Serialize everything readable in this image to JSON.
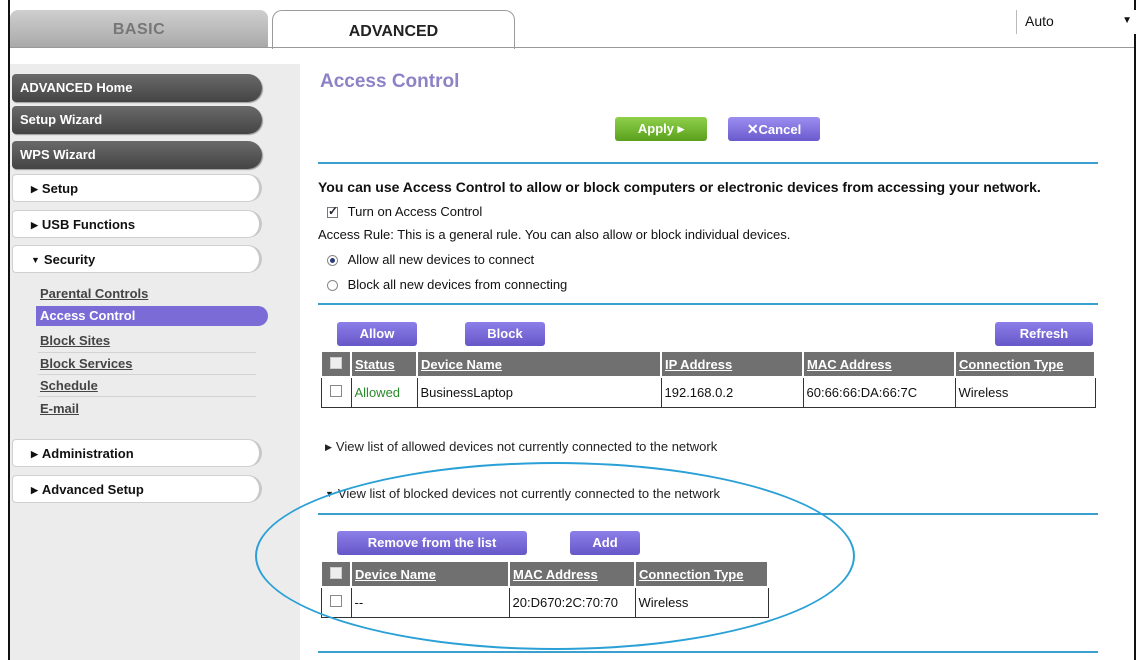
{
  "tabs": {
    "basic": "BASIC",
    "advanced": "ADVANCED"
  },
  "language_select": {
    "value": "Auto"
  },
  "sidebar": {
    "dark_items": [
      "ADVANCED Home",
      "Setup Wizard",
      "WPS Wizard"
    ],
    "sections": [
      "Setup",
      "USB Functions",
      "Security",
      "Administration",
      "Advanced Setup"
    ],
    "security_sub": [
      "Parental Controls",
      "Access Control",
      "Block Sites",
      "Block Services",
      "Schedule",
      "E-mail"
    ]
  },
  "main": {
    "title": "Access Control",
    "apply_label": "Apply ▸",
    "cancel_label": "Cancel",
    "intro": "You can use Access Control to allow or block computers or electronic devices from accessing your network.",
    "turn_on_label": "Turn on Access Control",
    "turn_on_checked": true,
    "rule_text": "Access Rule: This is a general rule. You can also allow or block individual devices.",
    "radio_allow": "Allow all new devices to connect",
    "radio_block": "Block all new devices from connecting",
    "selected_rule": "allow",
    "buttons": {
      "allow": "Allow",
      "block": "Block",
      "refresh": "Refresh"
    },
    "devices_table": {
      "headers": [
        "Status",
        "Device Name",
        "IP Address",
        "MAC Address",
        "Connection Type"
      ],
      "rows": [
        {
          "status": "Allowed",
          "device": "BusinessLaptop",
          "ip": "192.168.0.2",
          "mac": "60:66:66:DA:66:7C",
          "conn": "Wireless"
        }
      ]
    },
    "view_allowed": "View list of allowed devices not currently connected to the network",
    "view_blocked": "View list of blocked devices not currently connected to the network",
    "blocked_buttons": {
      "remove": "Remove from the list",
      "add": "Add"
    },
    "blocked_table": {
      "headers": [
        "Device Name",
        "MAC Address",
        "Connection Type"
      ],
      "rows": [
        {
          "device": "--",
          "mac": "20:D670:2C:70:70",
          "conn": "Wireless"
        }
      ]
    }
  },
  "colors": {
    "accent_purple": "#6a5acd",
    "apply_green": "#6ab52a",
    "highlight_blue": "#2aa0d6",
    "title_purple": "#8e82c6"
  }
}
